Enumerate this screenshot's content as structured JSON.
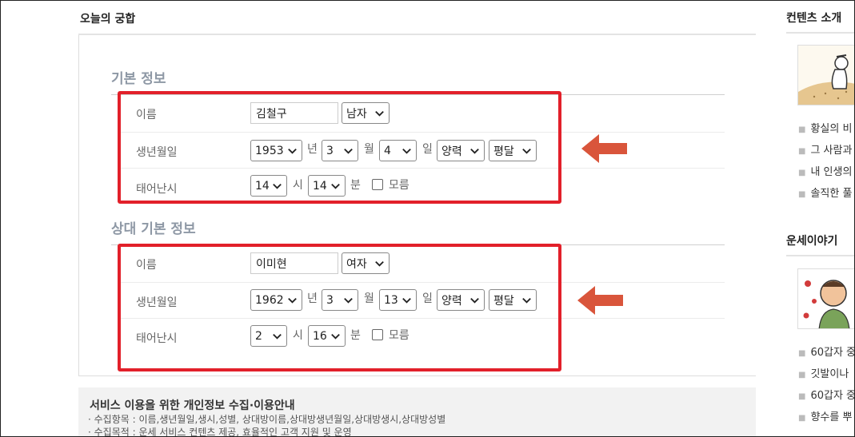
{
  "page": {
    "title": "오늘의 궁합"
  },
  "sections": [
    {
      "title": "기본 정보",
      "name_label": "이름",
      "name_value": "김철구",
      "gender": "남자",
      "birth_label": "생년월일",
      "year": "1953",
      "year_unit": "년",
      "month": "3",
      "month_unit": "월",
      "day": "4",
      "day_unit": "일",
      "calendar": "양력",
      "leap": "평달",
      "time_label": "태어난시",
      "hour": "14",
      "hour_unit": "시",
      "minute": "14",
      "minute_unit": "분",
      "unknown_label": "모름"
    },
    {
      "title": "상대 기본 정보",
      "name_label": "이름",
      "name_value": "이미현",
      "gender": "여자",
      "birth_label": "생년월일",
      "year": "1962",
      "year_unit": "년",
      "month": "3",
      "month_unit": "월",
      "day": "13",
      "day_unit": "일",
      "calendar": "양력",
      "leap": "평달",
      "time_label": "태어난시",
      "hour": "2",
      "hour_unit": "시",
      "minute": "16",
      "minute_unit": "분",
      "unknown_label": "모름"
    }
  ],
  "notice": {
    "title": "서비스 이용을 위한 개인정보 수집·이용안내",
    "lines": [
      "· 수집항목 : 이름,생년월일,생시,성별, 상대방이름,상대방생년월일,상대방생시,상대방성별",
      "· 수집목적 : 운세 서비스 컨텐츠 제공, 효율적인 고객 지원 및 운영"
    ]
  },
  "sidebar": {
    "blocks": [
      {
        "title": "컨텐츠 소개",
        "items": [
          "황실의 비",
          "그 사람과",
          "내 인생의",
          "솔직한 풀"
        ]
      },
      {
        "title": "운세이야기",
        "items": [
          "60갑자 중",
          "깃발이나",
          "60갑자 중",
          "향수를 뿌"
        ]
      }
    ]
  },
  "colors": {
    "highlight_box": "#e2202a",
    "arrow": "#d9553b",
    "section_title": "#8e98a5"
  }
}
